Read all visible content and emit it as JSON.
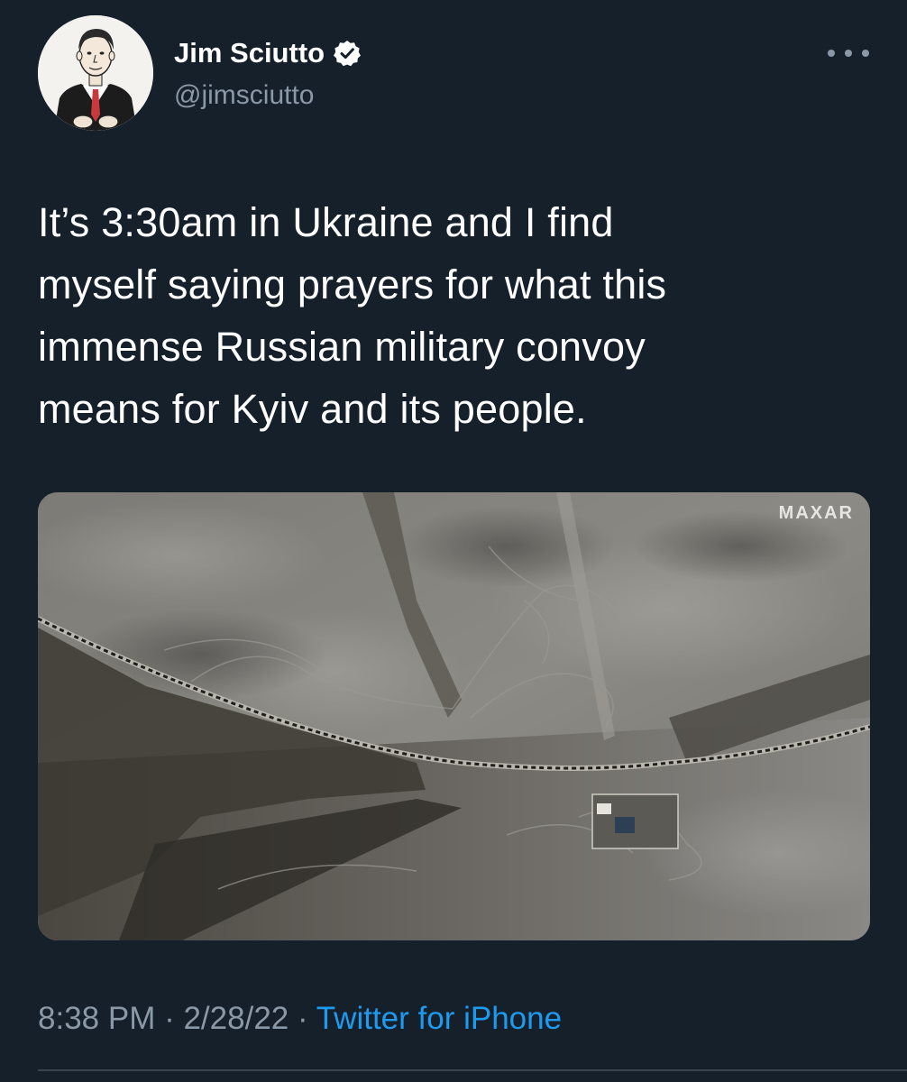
{
  "author": {
    "display_name": "Jim Sciutto",
    "handle": "@jimsciutto",
    "verified": true
  },
  "icons": {
    "verified": "verified-badge-icon",
    "more": "more-options-icon"
  },
  "tweet": {
    "text": "It’s 3:30am in Ukraine and I find\nmyself saying prayers for what this\nimmense Russian military convoy\nmeans for Kyiv and its people."
  },
  "media": {
    "watermark": "MAXAR"
  },
  "meta": {
    "time": "8:38 PM",
    "separator1": " · ",
    "date": "2/28/22",
    "separator2": " · ",
    "source": "Twitter for iPhone"
  },
  "colors": {
    "background": "#15202b",
    "text_primary": "#ffffff",
    "text_secondary": "#8b98a5",
    "link": "#1d9bf0",
    "divider": "#38444d"
  }
}
